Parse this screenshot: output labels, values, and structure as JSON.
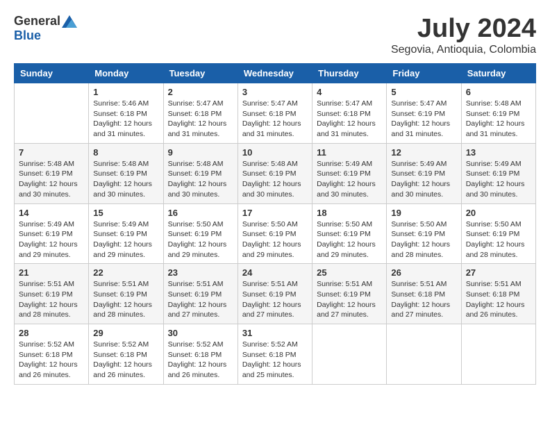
{
  "header": {
    "logo_general": "General",
    "logo_blue": "Blue",
    "month_year": "July 2024",
    "location": "Segovia, Antioquia, Colombia"
  },
  "calendar": {
    "days_of_week": [
      "Sunday",
      "Monday",
      "Tuesday",
      "Wednesday",
      "Thursday",
      "Friday",
      "Saturday"
    ],
    "weeks": [
      [
        {
          "day": "",
          "info": ""
        },
        {
          "day": "1",
          "info": "Sunrise: 5:46 AM\nSunset: 6:18 PM\nDaylight: 12 hours\nand 31 minutes."
        },
        {
          "day": "2",
          "info": "Sunrise: 5:47 AM\nSunset: 6:18 PM\nDaylight: 12 hours\nand 31 minutes."
        },
        {
          "day": "3",
          "info": "Sunrise: 5:47 AM\nSunset: 6:18 PM\nDaylight: 12 hours\nand 31 minutes."
        },
        {
          "day": "4",
          "info": "Sunrise: 5:47 AM\nSunset: 6:18 PM\nDaylight: 12 hours\nand 31 minutes."
        },
        {
          "day": "5",
          "info": "Sunrise: 5:47 AM\nSunset: 6:19 PM\nDaylight: 12 hours\nand 31 minutes."
        },
        {
          "day": "6",
          "info": "Sunrise: 5:48 AM\nSunset: 6:19 PM\nDaylight: 12 hours\nand 31 minutes."
        }
      ],
      [
        {
          "day": "7",
          "info": "Sunrise: 5:48 AM\nSunset: 6:19 PM\nDaylight: 12 hours\nand 30 minutes."
        },
        {
          "day": "8",
          "info": "Sunrise: 5:48 AM\nSunset: 6:19 PM\nDaylight: 12 hours\nand 30 minutes."
        },
        {
          "day": "9",
          "info": "Sunrise: 5:48 AM\nSunset: 6:19 PM\nDaylight: 12 hours\nand 30 minutes."
        },
        {
          "day": "10",
          "info": "Sunrise: 5:48 AM\nSunset: 6:19 PM\nDaylight: 12 hours\nand 30 minutes."
        },
        {
          "day": "11",
          "info": "Sunrise: 5:49 AM\nSunset: 6:19 PM\nDaylight: 12 hours\nand 30 minutes."
        },
        {
          "day": "12",
          "info": "Sunrise: 5:49 AM\nSunset: 6:19 PM\nDaylight: 12 hours\nand 30 minutes."
        },
        {
          "day": "13",
          "info": "Sunrise: 5:49 AM\nSunset: 6:19 PM\nDaylight: 12 hours\nand 30 minutes."
        }
      ],
      [
        {
          "day": "14",
          "info": "Sunrise: 5:49 AM\nSunset: 6:19 PM\nDaylight: 12 hours\nand 29 minutes."
        },
        {
          "day": "15",
          "info": "Sunrise: 5:49 AM\nSunset: 6:19 PM\nDaylight: 12 hours\nand 29 minutes."
        },
        {
          "day": "16",
          "info": "Sunrise: 5:50 AM\nSunset: 6:19 PM\nDaylight: 12 hours\nand 29 minutes."
        },
        {
          "day": "17",
          "info": "Sunrise: 5:50 AM\nSunset: 6:19 PM\nDaylight: 12 hours\nand 29 minutes."
        },
        {
          "day": "18",
          "info": "Sunrise: 5:50 AM\nSunset: 6:19 PM\nDaylight: 12 hours\nand 29 minutes."
        },
        {
          "day": "19",
          "info": "Sunrise: 5:50 AM\nSunset: 6:19 PM\nDaylight: 12 hours\nand 28 minutes."
        },
        {
          "day": "20",
          "info": "Sunrise: 5:50 AM\nSunset: 6:19 PM\nDaylight: 12 hours\nand 28 minutes."
        }
      ],
      [
        {
          "day": "21",
          "info": "Sunrise: 5:51 AM\nSunset: 6:19 PM\nDaylight: 12 hours\nand 28 minutes."
        },
        {
          "day": "22",
          "info": "Sunrise: 5:51 AM\nSunset: 6:19 PM\nDaylight: 12 hours\nand 28 minutes."
        },
        {
          "day": "23",
          "info": "Sunrise: 5:51 AM\nSunset: 6:19 PM\nDaylight: 12 hours\nand 27 minutes."
        },
        {
          "day": "24",
          "info": "Sunrise: 5:51 AM\nSunset: 6:19 PM\nDaylight: 12 hours\nand 27 minutes."
        },
        {
          "day": "25",
          "info": "Sunrise: 5:51 AM\nSunset: 6:19 PM\nDaylight: 12 hours\nand 27 minutes."
        },
        {
          "day": "26",
          "info": "Sunrise: 5:51 AM\nSunset: 6:18 PM\nDaylight: 12 hours\nand 27 minutes."
        },
        {
          "day": "27",
          "info": "Sunrise: 5:51 AM\nSunset: 6:18 PM\nDaylight: 12 hours\nand 26 minutes."
        }
      ],
      [
        {
          "day": "28",
          "info": "Sunrise: 5:52 AM\nSunset: 6:18 PM\nDaylight: 12 hours\nand 26 minutes."
        },
        {
          "day": "29",
          "info": "Sunrise: 5:52 AM\nSunset: 6:18 PM\nDaylight: 12 hours\nand 26 minutes."
        },
        {
          "day": "30",
          "info": "Sunrise: 5:52 AM\nSunset: 6:18 PM\nDaylight: 12 hours\nand 26 minutes."
        },
        {
          "day": "31",
          "info": "Sunrise: 5:52 AM\nSunset: 6:18 PM\nDaylight: 12 hours\nand 25 minutes."
        },
        {
          "day": "",
          "info": ""
        },
        {
          "day": "",
          "info": ""
        },
        {
          "day": "",
          "info": ""
        }
      ]
    ]
  }
}
